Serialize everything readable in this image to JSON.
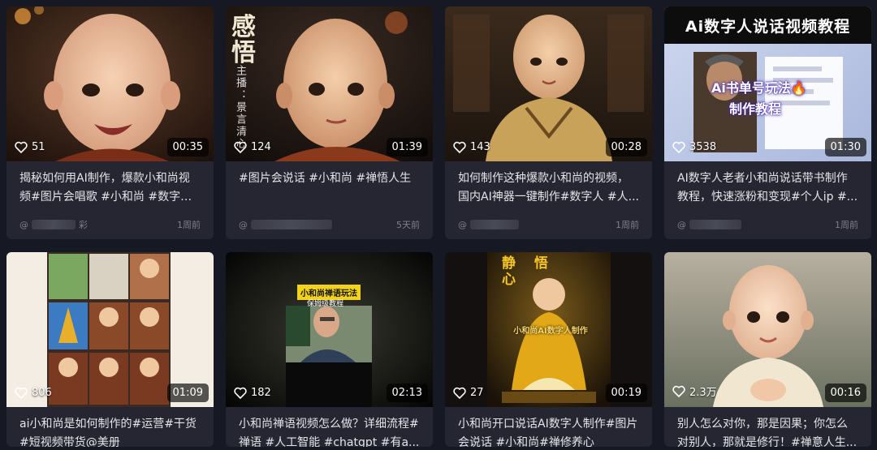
{
  "colors": {
    "page_bg": "#161823",
    "card_bg": "#252632",
    "text": "#e4e4e8",
    "meta": "#7d7f89"
  },
  "videos": [
    {
      "likes": "51",
      "duration": "00:35",
      "title": "揭秘如何用AI制作，爆款小和尚视频#图片会唱歌 #小和尚 #数字人...",
      "author": "@",
      "author_suffix": "彩",
      "time": "1周前"
    },
    {
      "likes": "124",
      "duration": "01:39",
      "title": "#图片会说话 #小和尚 #禅悟人生",
      "author": "@",
      "author_suffix": "",
      "time": "5天前",
      "overlay": {
        "chars": "感\n悟",
        "side": "主播：景言清心"
      }
    },
    {
      "likes": "143",
      "duration": "00:28",
      "title": "如何制作这种爆款小和尚的视频，国内AI神器一键制作#数字人 #人...",
      "author": "@",
      "author_suffix": "",
      "time": "1周前"
    },
    {
      "likes": "3538",
      "duration": "01:30",
      "title": "AI数字人老者小和尚说话带书制作教程，快速涨粉和变现#个人ip #...",
      "author": "@",
      "author_suffix": "",
      "time": "1周前",
      "overlay": {
        "banner": "Ai数字人说话视频教程",
        "sub1": "Ai书单号玩法🔥",
        "sub2": "制作教程"
      }
    },
    {
      "likes": "806",
      "duration": "01:09",
      "title": "ai小和尚是如何制作的#运营#干货#短视频带货@美册",
      "author": "",
      "author_suffix": "",
      "time": ""
    },
    {
      "likes": "182",
      "duration": "02:13",
      "title": "小和尚禅语视频怎么做？详细流程#禅语 #人工智能 #chatgpt #有a...",
      "author": "",
      "author_suffix": "",
      "time": "",
      "overlay": {
        "box": "小和尚禅语玩法",
        "sub": "保姆级教程"
      }
    },
    {
      "likes": "27",
      "duration": "00:19",
      "title": "小和尚开口说话AI数字人制作#图片会说话 #小和尚#禅修养心",
      "author": "",
      "author_suffix": "",
      "time": "",
      "overlay": {
        "chars": "静 悟\n心",
        "caption": "小和尚AI数字人制作"
      }
    },
    {
      "likes": "2.3万",
      "duration": "00:16",
      "title": "别人怎么对你，那是因果；你怎么对别人，那就是修行！#禅意人生...",
      "author": "",
      "author_suffix": "",
      "time": ""
    }
  ]
}
